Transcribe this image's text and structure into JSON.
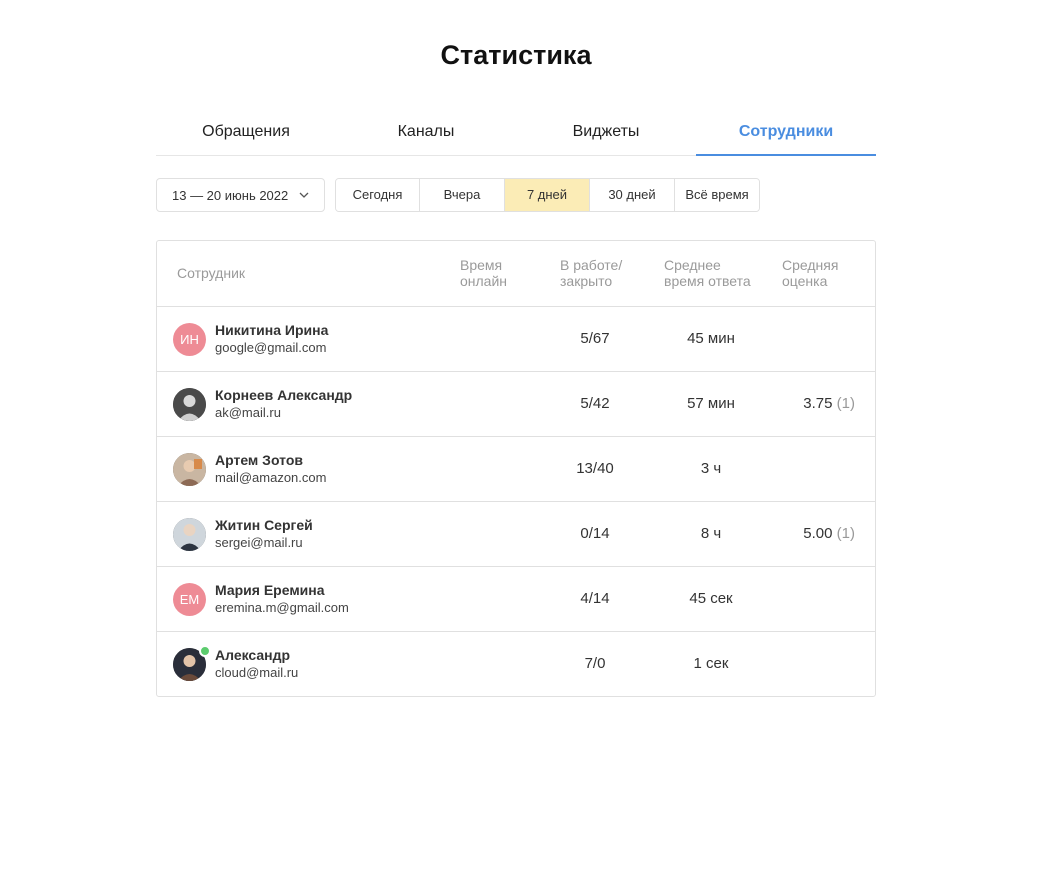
{
  "page": {
    "title": "Статистика"
  },
  "tabs": [
    {
      "label": "Обращения",
      "active": false
    },
    {
      "label": "Каналы",
      "active": false
    },
    {
      "label": "Виджеты",
      "active": false
    },
    {
      "label": "Сотрудники",
      "active": true
    }
  ],
  "filters": {
    "date_range": "13 — 20 июнь 2022",
    "periods": [
      {
        "label": "Сегодня",
        "active": false
      },
      {
        "label": "Вчера",
        "active": false
      },
      {
        "label": "7 дней",
        "active": true
      },
      {
        "label": "30 дней",
        "active": false
      },
      {
        "label": "Всё время",
        "active": false
      }
    ]
  },
  "table": {
    "headers": {
      "employee": "Сотрудник",
      "online_time_1": "Время",
      "online_time_2": "онлайн",
      "in_work_1": "В работе/",
      "in_work_2": "закрыто",
      "avg_response_1": "Среднее",
      "avg_response_2": "время ответа",
      "avg_rating_1": "Средняя",
      "avg_rating_2": "оценка"
    },
    "rows": [
      {
        "avatar": "initials",
        "initials": "ИН",
        "name": "Никитина Ирина",
        "email": "google@gmail.com",
        "online_time": "",
        "in_work": "5/67",
        "avg_response": "45 мин",
        "rating": "",
        "rating_count": "",
        "online": false
      },
      {
        "avatar": "photo",
        "initials": "",
        "name": "Корнеев Александр",
        "email": "ak@mail.ru",
        "online_time": "",
        "in_work": "5/42",
        "avg_response": "57 мин",
        "rating": "3.75",
        "rating_count": "(1)",
        "online": false
      },
      {
        "avatar": "photo",
        "initials": "",
        "name": "Артем Зотов",
        "email": "mail@amazon.com",
        "online_time": "",
        "in_work": "13/40",
        "avg_response": "3 ч",
        "rating": "",
        "rating_count": "",
        "online": false
      },
      {
        "avatar": "photo",
        "initials": "",
        "name": "Житин Сергей",
        "email": "sergei@mail.ru",
        "online_time": "",
        "in_work": "0/14",
        "avg_response": "8 ч",
        "rating": "5.00",
        "rating_count": "(1)",
        "online": false
      },
      {
        "avatar": "initials",
        "initials": "ЕМ",
        "name": "Мария Еремина",
        "email": "eremina.m@gmail.com",
        "online_time": "",
        "in_work": "4/14",
        "avg_response": "45 сек",
        "rating": "",
        "rating_count": "",
        "online": false
      },
      {
        "avatar": "photo",
        "initials": "",
        "name": "Александр",
        "email": "cloud@mail.ru",
        "online_time": "",
        "in_work": "7/0",
        "avg_response": "1 сек",
        "rating": "",
        "rating_count": "",
        "online": true
      }
    ]
  },
  "colors": {
    "accent": "#4a8de0",
    "active_period": "#fbecb6",
    "avatar_initials": "#ee8b95",
    "online": "#5ccc6e"
  },
  "icons": {
    "date_dropdown": "chevron-down-icon",
    "online_status": "online-dot-icon"
  }
}
